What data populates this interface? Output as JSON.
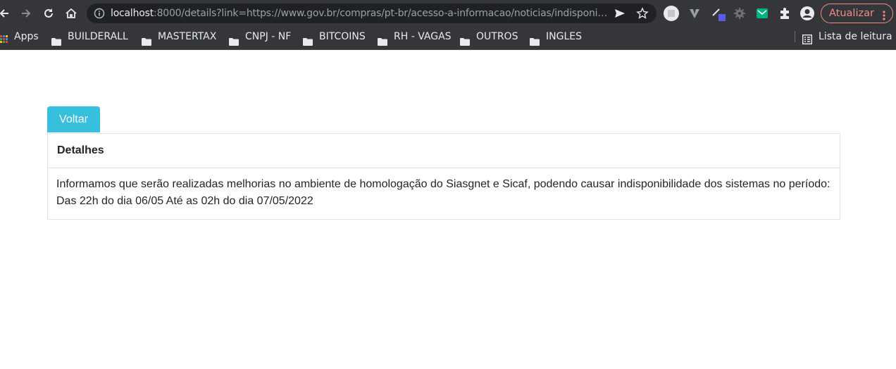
{
  "browser": {
    "url_host": "localhost",
    "url_rest": ":8000/details?link=https://www.gov.br/compras/pt-br/acesso-a-informacao/noticias/indisponibilidad...",
    "update_label": "Atualizar",
    "icons": {
      "back": "back-arrow-icon",
      "forward": "forward-arrow-icon",
      "reload": "reload-icon",
      "home": "home-icon",
      "info": "info-icon",
      "send": "send-icon",
      "star": "star-icon",
      "extensions": "puzzle-icon",
      "profile": "profile-icon",
      "menu": "kebab-menu-icon"
    },
    "colors": {
      "update_accent": "#f28b82",
      "chrome_bg": "#35363a"
    }
  },
  "bookmarks": {
    "apps_label": "Apps",
    "folders": [
      "BUILDERALL",
      "MASTERTAX",
      "CNPJ - NF",
      "BITCOINS",
      "RH - VAGAS",
      "OUTROS",
      "INGLES"
    ],
    "reading_list_label": "Lista de leitura"
  },
  "page": {
    "back_button_label": "Voltar",
    "card_title": "Detalhes",
    "card_text_line1": "Informamos que serão realizadas melhorias no ambiente de homologação do Siasgnet e Sicaf, podendo causar indisponibilidade dos sistemas no período:",
    "card_text_line2": "Das 22h do dia 06/05 Até as 02h do dia 07/05/2022",
    "colors": {
      "button_bg": "#36c0dd",
      "border": "#e3e3e3"
    }
  }
}
